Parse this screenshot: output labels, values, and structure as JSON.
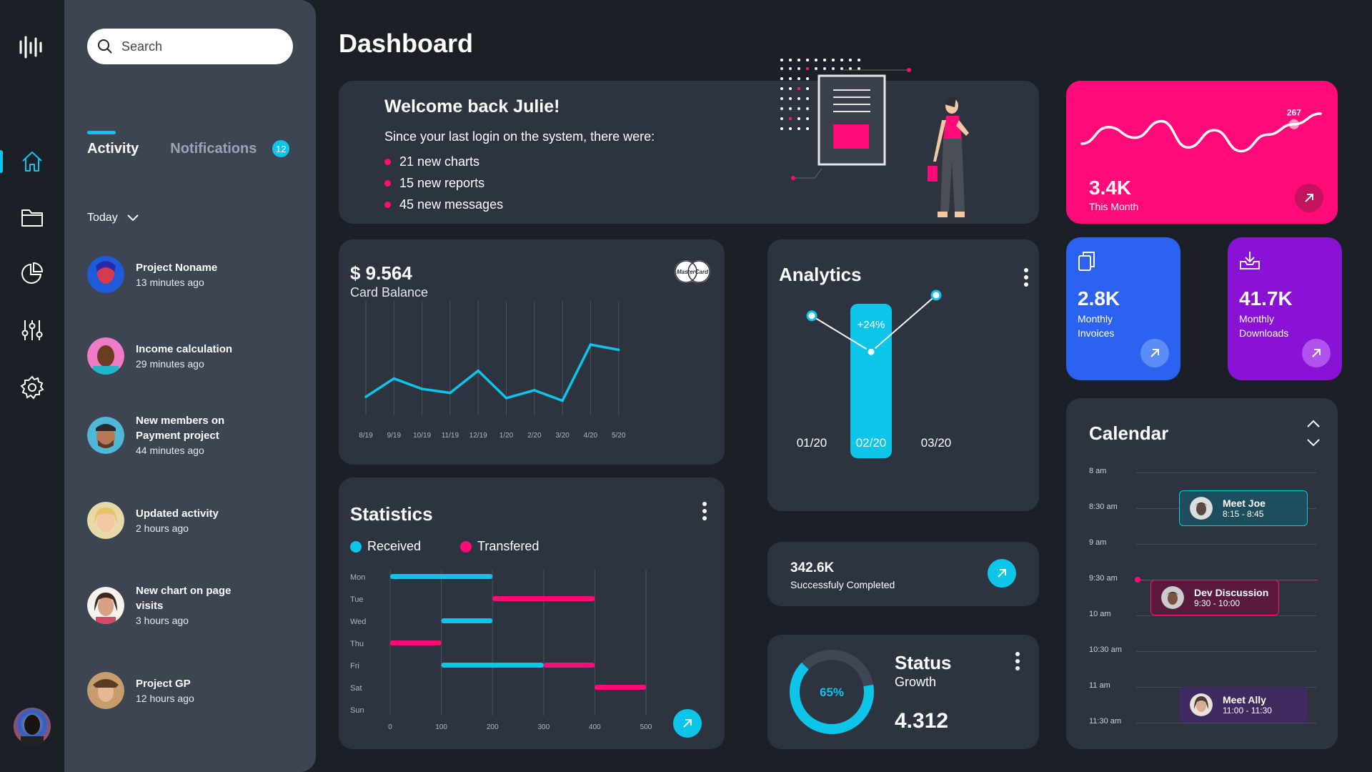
{
  "colors": {
    "accent": "#0dc5e9",
    "pink": "#ff0a78",
    "blue": "#2c62f0",
    "purple": "#8a11d6"
  },
  "rail": {
    "icons": [
      "home-icon",
      "folder-icon",
      "pie-chart-icon",
      "sliders-icon",
      "settings-icon"
    ]
  },
  "search": {
    "placeholder": "Search"
  },
  "tabs": {
    "activity": "Activity",
    "notifications": "Notifications",
    "notifications_count": "12"
  },
  "filter": {
    "label": "Today"
  },
  "activity": [
    {
      "title": "Project Noname",
      "time": "13 minutes ago"
    },
    {
      "title": "Income calculation",
      "time": "29 minutes ago"
    },
    {
      "title": "New members on Payment project",
      "time": "44 minutes ago"
    },
    {
      "title": "Updated activity",
      "time": "2 hours ago"
    },
    {
      "title": "New chart on page visits",
      "time": "3 hours ago"
    },
    {
      "title": "Project GP",
      "time": "12 hours ago"
    }
  ],
  "page_title": "Dashboard",
  "welcome": {
    "title": "Welcome back Julie!",
    "intro": "Since your last login on the system, there were:",
    "items": [
      "21 new charts",
      "15 new reports",
      "45 new messages"
    ]
  },
  "balance": {
    "amount": "$ 9.564",
    "label": "Card Balance",
    "card_brand": "MasterCard"
  },
  "chart_data": [
    {
      "type": "line",
      "categories": [
        "8/19",
        "9/19",
        "10/19",
        "11/19",
        "12/19",
        "1/20",
        "2/20",
        "3/20",
        "4/20",
        "5/20"
      ],
      "values": [
        12,
        26,
        18,
        15,
        32,
        11,
        17,
        9,
        52,
        48
      ],
      "ylim": [
        0,
        80
      ],
      "grid": "vertical"
    },
    {
      "type": "line",
      "title": "Analytics",
      "categories": [
        "01/20",
        "02/20",
        "03/20"
      ],
      "values": [
        62,
        48,
        70
      ],
      "highlight": {
        "category": "02/20",
        "label": "+24%"
      }
    },
    {
      "type": "bar",
      "orientation": "horizontal-range",
      "title": "Statistics",
      "categories": [
        "Mon",
        "Tue",
        "Wed",
        "Thu",
        "Fri",
        "Sat",
        "Sun"
      ],
      "x_ticks": [
        0,
        100,
        200,
        300,
        400,
        500
      ],
      "xlim": [
        0,
        500
      ],
      "series": [
        {
          "name": "Received",
          "color": "#0dc5e9",
          "ranges": [
            [
              0,
              200
            ],
            null,
            [
              100,
              200
            ],
            null,
            [
              100,
              300
            ],
            null,
            null
          ]
        },
        {
          "name": "Transfered",
          "color": "#ff0a78",
          "ranges": [
            null,
            [
              200,
              400
            ],
            null,
            [
              0,
              100
            ],
            [
              300,
              400
            ],
            [
              400,
              500
            ],
            null
          ]
        }
      ]
    },
    {
      "type": "line",
      "values": [
        40,
        62,
        48,
        70,
        35,
        58,
        30,
        52,
        66,
        80
      ],
      "annotation": {
        "index": 8,
        "label": "267"
      }
    },
    {
      "type": "pie",
      "title": "Status",
      "values": [
        65
      ],
      "label": "65%"
    }
  ],
  "completed": {
    "value": "342.6K",
    "label": "Successfuly Completed"
  },
  "status": {
    "title": "Status",
    "subtitle": "Growth",
    "value": "4.312",
    "percent_label": "65%"
  },
  "hero": {
    "value": "3.4K",
    "label": "This Month"
  },
  "invoices": {
    "value": "2.8K",
    "label": "Monthly Invoices"
  },
  "downloads": {
    "value": "41.7K",
    "label": "Monthly Downloads"
  },
  "calendar": {
    "title": "Calendar",
    "times": [
      "8 am",
      "8:30 am",
      "9 am",
      "9:30 am",
      "10 am",
      "10:30 am",
      "11 am",
      "11:30 am"
    ],
    "events": [
      {
        "title": "Meet Joe",
        "time": "8:15 - 8:45"
      },
      {
        "title": "Dev Discussion",
        "time": "9:30 - 10:00"
      },
      {
        "title": "Meet Ally",
        "time": "11:00 - 11:30"
      }
    ]
  }
}
